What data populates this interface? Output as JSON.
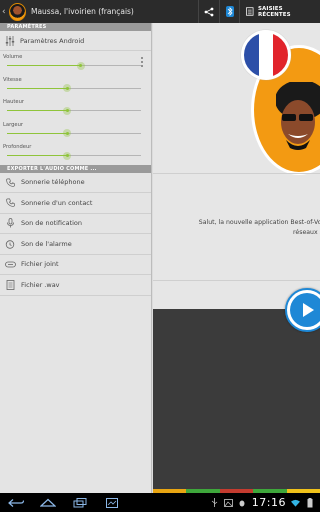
{
  "actionbar": {
    "title": "Maussa, l'ivoirien (français)",
    "recent_label": "SAISIES RÉCENTES"
  },
  "settings": {
    "section_header": "PARAMÈTRES",
    "android_params_label": "Paramètres Android",
    "sliders": [
      {
        "label": "Volume",
        "value": 0.55
      },
      {
        "label": "Vitesse",
        "value": 0.45
      },
      {
        "label": "Hauteur",
        "value": 0.45
      },
      {
        "label": "Largeur",
        "value": 0.45
      },
      {
        "label": "Profondeur",
        "value": 0.45
      }
    ]
  },
  "export": {
    "section_header": "EXPORTER L'AUDIO COMME ...",
    "items": [
      {
        "label": "Sonnerie téléphone",
        "icon": "phone-icon"
      },
      {
        "label": "Sonnerie d'un contact",
        "icon": "phone-icon"
      },
      {
        "label": "Son de notification",
        "icon": "mic-icon"
      },
      {
        "label": "Son de l'alarme",
        "icon": "alarm-icon"
      },
      {
        "label": "Fichier joint",
        "icon": "attachment-icon"
      },
      {
        "label": "Fichier .wav",
        "icon": "file-icon"
      }
    ]
  },
  "content": {
    "message_line1": "Salut, la nouvelle application Best-of-Vox per",
    "message_line2": "réseaux so"
  },
  "colors": {
    "accent": "#8fc43b",
    "play": "#1e88d6",
    "avatar_bg": "#f39a12",
    "bar": [
      "#e8a512",
      "#3ea73b",
      "#c43b2f",
      "#3ea73b",
      "#f0c21a"
    ]
  },
  "systembar": {
    "clock": "17:16"
  }
}
